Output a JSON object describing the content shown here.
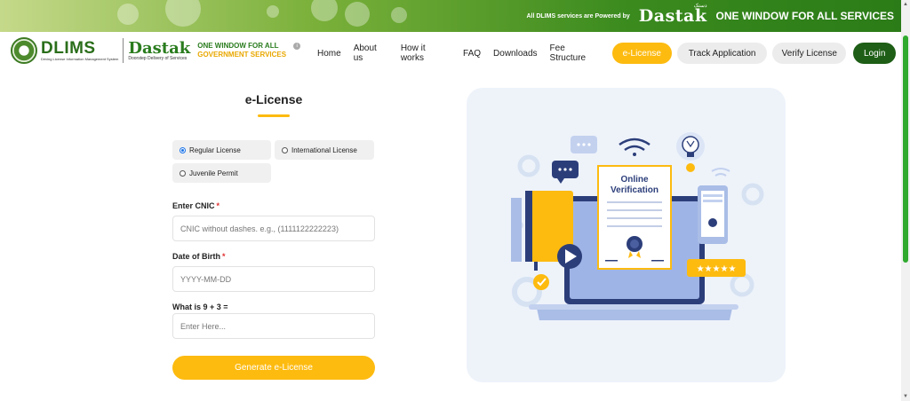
{
  "banner": {
    "powered_by": "All DLIMS services are Powered by",
    "dastak_logo": "Dastak",
    "dastak_urdu": "دستک",
    "tagline": "ONE WINDOW FOR ALL SERVICES"
  },
  "header": {
    "dlims": "DLIMS",
    "dlims_sub": "Driving License Information Management System",
    "dastak": "Dastak",
    "dastak_sub": "Doorstep Delivery of Services",
    "ow_line1": "ONE WINDOW FOR ALL",
    "ow_line2": "GOVERNMENT SERVICES",
    "info_icon": "i"
  },
  "nav": {
    "home": "Home",
    "about": "About us",
    "how": "How it works",
    "faq": "FAQ",
    "downloads": "Downloads",
    "fee": "Fee Structure",
    "elicense": "e-License",
    "track": "Track Application",
    "verify": "Verify License",
    "login": "Login"
  },
  "form": {
    "title": "e-License",
    "license_types": [
      {
        "label": "Regular License",
        "checked": true
      },
      {
        "label": "International License",
        "checked": false
      },
      {
        "label": "Juvenile Permit",
        "checked": false
      }
    ],
    "cnic_label": "Enter CNIC",
    "cnic_placeholder": "CNIC without dashes. e.g., (1111122222223)",
    "dob_label": "Date of Birth",
    "dob_placeholder": "YYYY-MM-DD",
    "captcha_label": "What is 9 + 3 =",
    "captcha_placeholder": "Enter Here...",
    "required_mark": "*",
    "submit": "Generate e-License"
  },
  "illustration": {
    "cert_line1": "Online",
    "cert_line2": "Verification",
    "stars": "★★★★★"
  },
  "colors": {
    "brand_green": "#2a7c1e",
    "accent_yellow": "#fdbb10",
    "login_green": "#1e5e16",
    "navy": "#2c3e7a"
  }
}
